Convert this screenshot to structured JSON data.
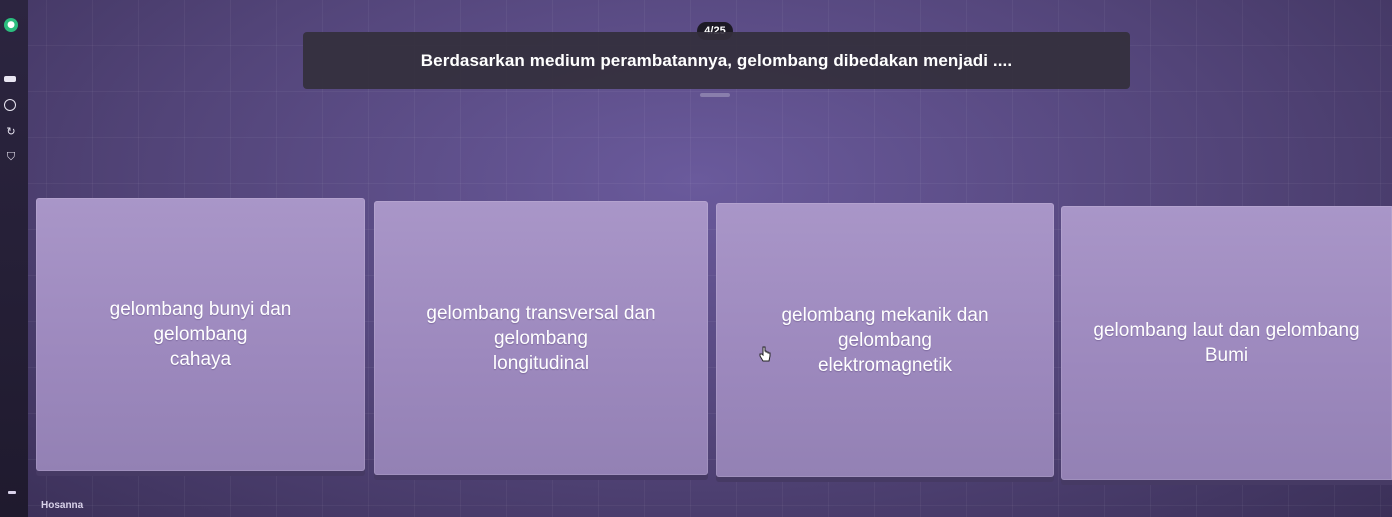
{
  "quiz": {
    "counter": "4/25",
    "question": "Berdasarkan medium perambatannya, gelombang dibedakan menjadi ...."
  },
  "options": [
    {
      "label": "gelombang bunyi dan\ngelombang\ncahaya"
    },
    {
      "label": "gelombang transversal dan\ngelombang\nlongitudinal"
    },
    {
      "label": "gelombang mekanik dan\ngelombang\nelektromagnetik"
    },
    {
      "label": "gelombang laut dan gelombang\nBumi"
    }
  ],
  "player": {
    "name": "Hosanna"
  },
  "icons": {
    "rail": [
      "logo-icon",
      "bar-icon",
      "clock-icon",
      "redo-icon",
      "shield-icon"
    ],
    "cursor": "hand-cursor-icon"
  },
  "colors": {
    "background": "#524478",
    "question_bar": "#342f3c",
    "option_card": "#a996c8",
    "counter_pill": "#1d1a25"
  }
}
